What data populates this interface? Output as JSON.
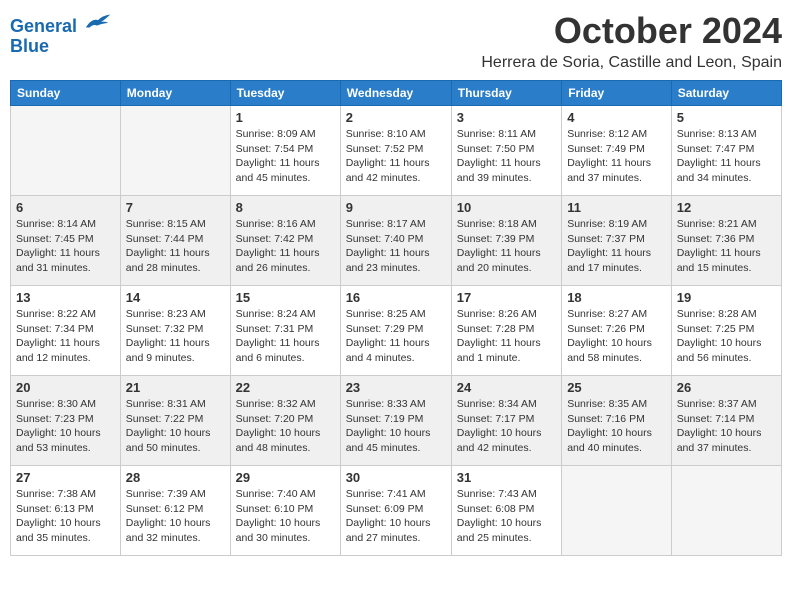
{
  "header": {
    "logo_line1": "General",
    "logo_line2": "Blue",
    "month": "October 2024",
    "location": "Herrera de Soria, Castille and Leon, Spain"
  },
  "weekdays": [
    "Sunday",
    "Monday",
    "Tuesday",
    "Wednesday",
    "Thursday",
    "Friday",
    "Saturday"
  ],
  "weeks": [
    [
      {
        "day": "",
        "info": ""
      },
      {
        "day": "",
        "info": ""
      },
      {
        "day": "1",
        "info": "Sunrise: 8:09 AM\nSunset: 7:54 PM\nDaylight: 11 hours and 45 minutes."
      },
      {
        "day": "2",
        "info": "Sunrise: 8:10 AM\nSunset: 7:52 PM\nDaylight: 11 hours and 42 minutes."
      },
      {
        "day": "3",
        "info": "Sunrise: 8:11 AM\nSunset: 7:50 PM\nDaylight: 11 hours and 39 minutes."
      },
      {
        "day": "4",
        "info": "Sunrise: 8:12 AM\nSunset: 7:49 PM\nDaylight: 11 hours and 37 minutes."
      },
      {
        "day": "5",
        "info": "Sunrise: 8:13 AM\nSunset: 7:47 PM\nDaylight: 11 hours and 34 minutes."
      }
    ],
    [
      {
        "day": "6",
        "info": "Sunrise: 8:14 AM\nSunset: 7:45 PM\nDaylight: 11 hours and 31 minutes."
      },
      {
        "day": "7",
        "info": "Sunrise: 8:15 AM\nSunset: 7:44 PM\nDaylight: 11 hours and 28 minutes."
      },
      {
        "day": "8",
        "info": "Sunrise: 8:16 AM\nSunset: 7:42 PM\nDaylight: 11 hours and 26 minutes."
      },
      {
        "day": "9",
        "info": "Sunrise: 8:17 AM\nSunset: 7:40 PM\nDaylight: 11 hours and 23 minutes."
      },
      {
        "day": "10",
        "info": "Sunrise: 8:18 AM\nSunset: 7:39 PM\nDaylight: 11 hours and 20 minutes."
      },
      {
        "day": "11",
        "info": "Sunrise: 8:19 AM\nSunset: 7:37 PM\nDaylight: 11 hours and 17 minutes."
      },
      {
        "day": "12",
        "info": "Sunrise: 8:21 AM\nSunset: 7:36 PM\nDaylight: 11 hours and 15 minutes."
      }
    ],
    [
      {
        "day": "13",
        "info": "Sunrise: 8:22 AM\nSunset: 7:34 PM\nDaylight: 11 hours and 12 minutes."
      },
      {
        "day": "14",
        "info": "Sunrise: 8:23 AM\nSunset: 7:32 PM\nDaylight: 11 hours and 9 minutes."
      },
      {
        "day": "15",
        "info": "Sunrise: 8:24 AM\nSunset: 7:31 PM\nDaylight: 11 hours and 6 minutes."
      },
      {
        "day": "16",
        "info": "Sunrise: 8:25 AM\nSunset: 7:29 PM\nDaylight: 11 hours and 4 minutes."
      },
      {
        "day": "17",
        "info": "Sunrise: 8:26 AM\nSunset: 7:28 PM\nDaylight: 11 hours and 1 minute."
      },
      {
        "day": "18",
        "info": "Sunrise: 8:27 AM\nSunset: 7:26 PM\nDaylight: 10 hours and 58 minutes."
      },
      {
        "day": "19",
        "info": "Sunrise: 8:28 AM\nSunset: 7:25 PM\nDaylight: 10 hours and 56 minutes."
      }
    ],
    [
      {
        "day": "20",
        "info": "Sunrise: 8:30 AM\nSunset: 7:23 PM\nDaylight: 10 hours and 53 minutes."
      },
      {
        "day": "21",
        "info": "Sunrise: 8:31 AM\nSunset: 7:22 PM\nDaylight: 10 hours and 50 minutes."
      },
      {
        "day": "22",
        "info": "Sunrise: 8:32 AM\nSunset: 7:20 PM\nDaylight: 10 hours and 48 minutes."
      },
      {
        "day": "23",
        "info": "Sunrise: 8:33 AM\nSunset: 7:19 PM\nDaylight: 10 hours and 45 minutes."
      },
      {
        "day": "24",
        "info": "Sunrise: 8:34 AM\nSunset: 7:17 PM\nDaylight: 10 hours and 42 minutes."
      },
      {
        "day": "25",
        "info": "Sunrise: 8:35 AM\nSunset: 7:16 PM\nDaylight: 10 hours and 40 minutes."
      },
      {
        "day": "26",
        "info": "Sunrise: 8:37 AM\nSunset: 7:14 PM\nDaylight: 10 hours and 37 minutes."
      }
    ],
    [
      {
        "day": "27",
        "info": "Sunrise: 7:38 AM\nSunset: 6:13 PM\nDaylight: 10 hours and 35 minutes."
      },
      {
        "day": "28",
        "info": "Sunrise: 7:39 AM\nSunset: 6:12 PM\nDaylight: 10 hours and 32 minutes."
      },
      {
        "day": "29",
        "info": "Sunrise: 7:40 AM\nSunset: 6:10 PM\nDaylight: 10 hours and 30 minutes."
      },
      {
        "day": "30",
        "info": "Sunrise: 7:41 AM\nSunset: 6:09 PM\nDaylight: 10 hours and 27 minutes."
      },
      {
        "day": "31",
        "info": "Sunrise: 7:43 AM\nSunset: 6:08 PM\nDaylight: 10 hours and 25 minutes."
      },
      {
        "day": "",
        "info": ""
      },
      {
        "day": "",
        "info": ""
      }
    ]
  ]
}
